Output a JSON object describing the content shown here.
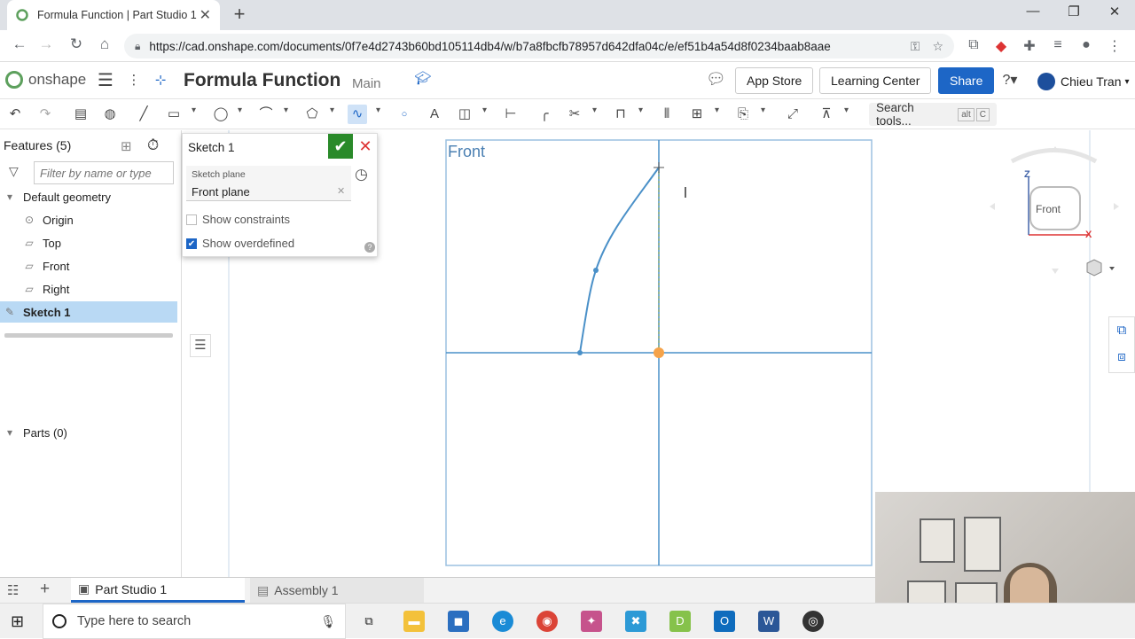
{
  "browser": {
    "tab_title": "Formula Function | Part Studio 1",
    "url": "https://cad.onshape.com/documents/0f7e4d2743b60bd105114db4/w/b7a8fbcfb78957d642dfa04c/e/ef51b4a54d8f0234baab8aae"
  },
  "header": {
    "logo_text": "onshape",
    "doc_name": "Formula Function",
    "branch": "Main",
    "app_store": "App Store",
    "learning_center": "Learning Center",
    "share": "Share",
    "user": "Chieu Tran"
  },
  "toolbar": {
    "search_label": "Search tools...",
    "search_kbd_1": "alt",
    "search_kbd_2": "C"
  },
  "features": {
    "heading": "Features (5)",
    "filter_placeholder": "Filter by name or type",
    "default_geometry": "Default geometry",
    "items": [
      {
        "label": "Origin",
        "icon": "origin-icon"
      },
      {
        "label": "Top",
        "icon": "plane-icon"
      },
      {
        "label": "Front",
        "icon": "plane-icon"
      },
      {
        "label": "Right",
        "icon": "plane-icon"
      }
    ],
    "sketch": "Sketch 1",
    "parts": "Parts (0)"
  },
  "sketch_dialog": {
    "title": "Sketch 1",
    "plane_label": "Sketch plane",
    "plane_value": "Front plane",
    "show_constraints": "Show constraints",
    "show_overdefined": "Show overdefined",
    "show_constraints_checked": false,
    "show_overdefined_checked": true
  },
  "canvas": {
    "view_label": "Front",
    "cube_label": "Front",
    "axis_z": "Z",
    "axis_x": "X"
  },
  "bottom_tabs": [
    {
      "label": "Part Studio 1",
      "active": true
    },
    {
      "label": "Assembly 1",
      "active": false
    }
  ],
  "taskbar": {
    "search_text": "Type here to search"
  },
  "colors": {
    "accent": "#1d66c6",
    "sketch_line": "#4a90c8",
    "origin": "#f5a34a",
    "confirm": "#2a8a2a"
  }
}
